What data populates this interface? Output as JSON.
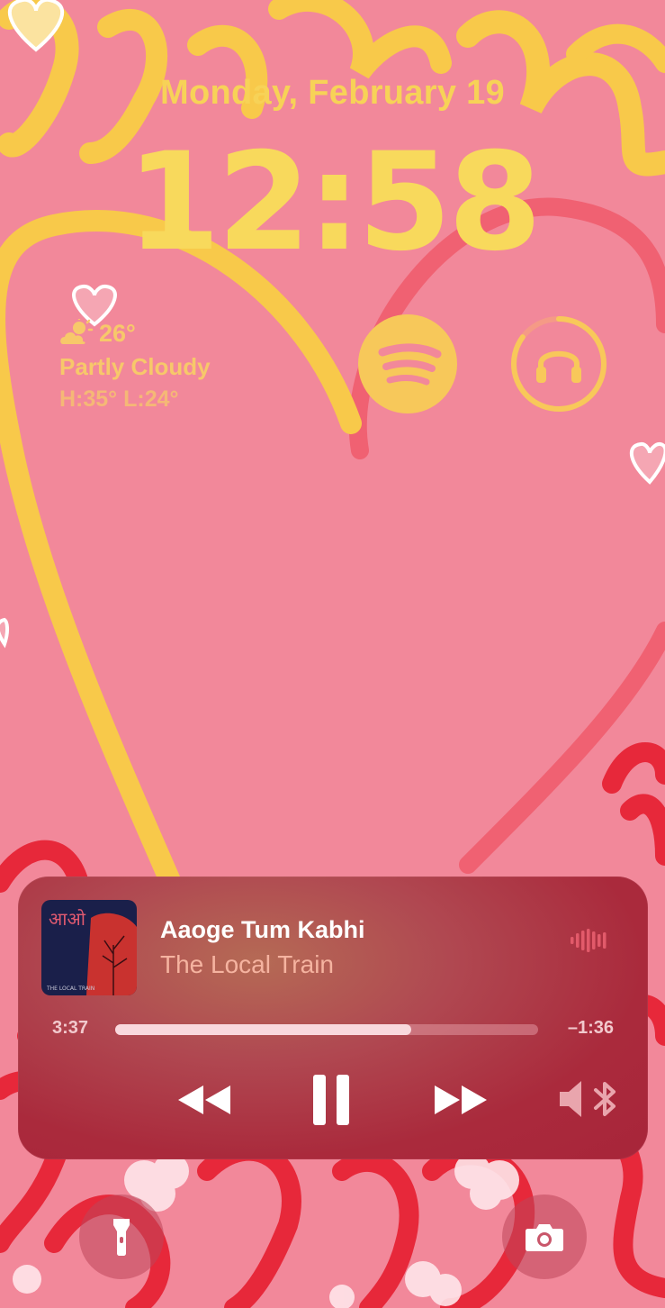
{
  "lockscreen": {
    "date": "Monday, February 19",
    "time": "12:58"
  },
  "weather": {
    "icon": "partly-cloudy-icon",
    "temperature": "26°",
    "condition": "Partly Cloudy",
    "high_low": "H:35° L:24°"
  },
  "widgets": {
    "left_icon": "spotify-icon",
    "right_icon": "headphones-icon",
    "right_level": 0.85
  },
  "now_playing": {
    "title": "Aaoge Tum Kabhi",
    "artist": "The Local Train",
    "elapsed": "3:37",
    "remaining": "–1:36",
    "progress": 0.7,
    "album_art": {
      "script_label": "आओ",
      "caption": "THE LOCAL TRAIN"
    }
  },
  "colors": {
    "wallpaper": "#f2889a",
    "yellow": "#f8d55a",
    "red_heart": "#e7283a",
    "player_bg": "#aa2a3c"
  },
  "quick_actions": {
    "left_icon": "flashlight-icon",
    "right_icon": "camera-icon"
  }
}
